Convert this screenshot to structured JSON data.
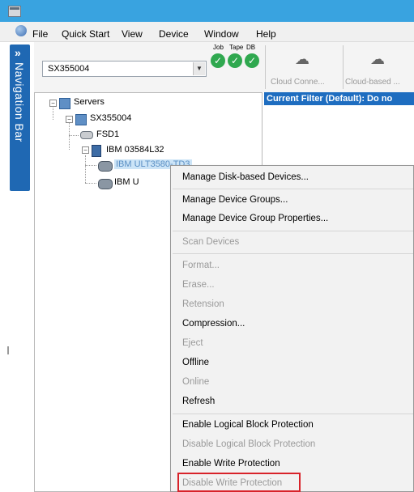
{
  "menubar": {
    "items": [
      "File",
      "Quick Start",
      "View",
      "Device",
      "Window",
      "Help"
    ]
  },
  "navigation_bar": {
    "arrows": "»",
    "label": "Navigation Bar"
  },
  "toolbar": {
    "server_combo_value": "SX355004",
    "status_labels": [
      "Job",
      "Tape",
      "DB"
    ],
    "buttons": [
      "Cloud Conne...",
      "Cloud-based ..."
    ]
  },
  "tree": {
    "nodes": [
      {
        "label": "Servers",
        "icon": "servers-icon"
      },
      {
        "label": "SX355004",
        "icon": "server-icon"
      },
      {
        "label": "FSD1",
        "icon": "disk-icon"
      },
      {
        "label": "IBM 03584L32",
        "icon": "tape-library-icon"
      },
      {
        "label": "IBM ULT3580-TD3",
        "icon": "tape-drive-icon",
        "selected": true
      },
      {
        "label": "IBM U",
        "icon": "tape-drive-icon"
      }
    ]
  },
  "filter_bar": {
    "text": "Current Filter (Default):  Do no"
  },
  "context_menu": {
    "groups": [
      [
        {
          "label": "Manage Disk-based Devices...",
          "enabled": true
        }
      ],
      [
        {
          "label": "Manage Device Groups...",
          "enabled": true
        },
        {
          "label": "Manage Device Group Properties...",
          "enabled": true
        }
      ],
      [
        {
          "label": "Scan Devices",
          "enabled": false
        }
      ],
      [
        {
          "label": "Format...",
          "enabled": false
        },
        {
          "label": "Erase...",
          "enabled": false
        },
        {
          "label": "Retension",
          "enabled": false
        },
        {
          "label": "Compression...",
          "enabled": true
        },
        {
          "label": "Eject",
          "enabled": false
        },
        {
          "label": "Offline",
          "enabled": true
        },
        {
          "label": "Online",
          "enabled": false
        },
        {
          "label": "Refresh",
          "enabled": true
        }
      ],
      [
        {
          "label": "Enable Logical Block Protection",
          "enabled": true
        },
        {
          "label": "Disable Logical Block Protection",
          "enabled": false
        },
        {
          "label": "Enable Write Protection",
          "enabled": true
        },
        {
          "label": "Disable Write Protection",
          "enabled": false,
          "highlighted": true
        }
      ]
    ]
  },
  "colors": {
    "titlebar": "#39a3e0",
    "navigation_bar": "#1f68b3",
    "filter_bar": "#1e6dc0",
    "selection": "#cce4f7",
    "highlight_box": "#d8232a",
    "status_ok": "#2fa84f"
  }
}
